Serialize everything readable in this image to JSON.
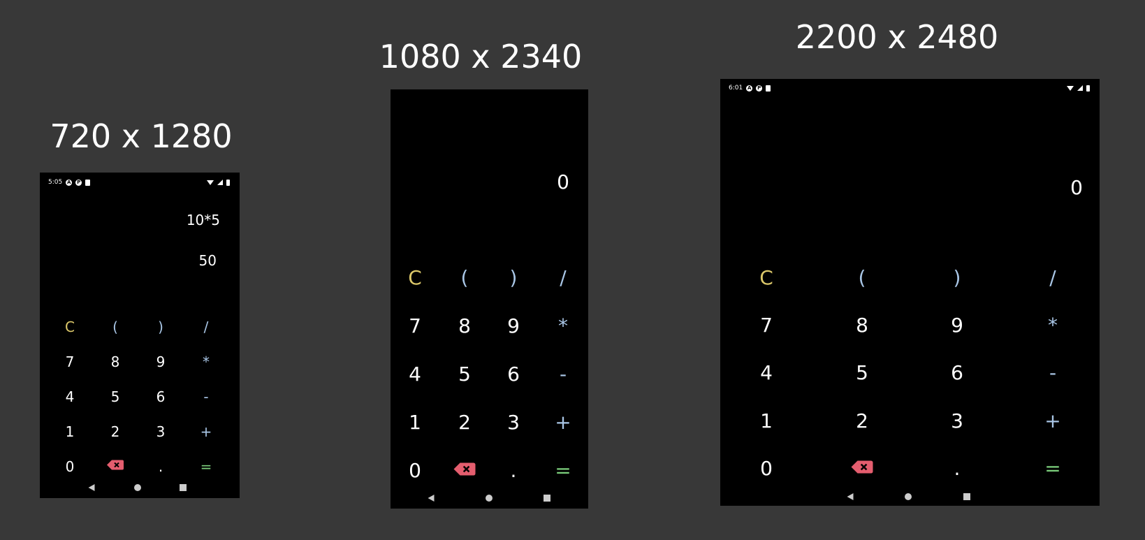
{
  "titles": {
    "small": "720 x 1280",
    "medium": "1080 x 2340",
    "large": "2200 x 2480"
  },
  "small": {
    "status": {
      "time": "5:05",
      "icon1": "A",
      "icon2": "P"
    },
    "expression": "10*5",
    "result": "50"
  },
  "medium": {
    "result": "0"
  },
  "large": {
    "status": {
      "time": "6:01",
      "icon1": "A",
      "icon2": "P"
    },
    "result": "0"
  },
  "keys": {
    "clear": "C",
    "open_paren": "(",
    "close_paren": ")",
    "divide": "/",
    "seven": "7",
    "eight": "8",
    "nine": "9",
    "multiply": "*",
    "four": "4",
    "five": "5",
    "six": "6",
    "subtract": "-",
    "one": "1",
    "two": "2",
    "three": "3",
    "add": "+",
    "zero": "0",
    "backspace_icon": "backspace-icon",
    "decimal": ".",
    "equals": "="
  },
  "colors": {
    "background": "#383838",
    "screen": "#000000",
    "clear_key": "#dcc86a",
    "operator_key": "#a9c6e6",
    "number_key": "#ffffff",
    "equals_key": "#7ccf7c",
    "backspace_key": "#e45d6e"
  }
}
